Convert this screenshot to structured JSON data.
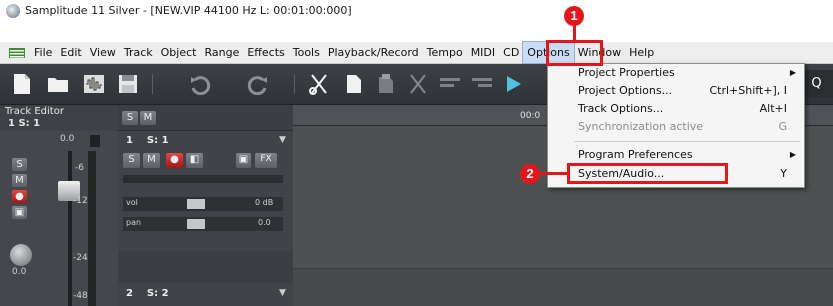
{
  "window": {
    "title": "Samplitude 11 Silver - [NEW.VIP   44100 Hz L: 00:01:00:000]"
  },
  "menubar": {
    "items": [
      "File",
      "Edit",
      "View",
      "Track",
      "Object",
      "Range",
      "Effects",
      "Tools",
      "Playback/Record",
      "Tempo",
      "MIDI",
      "CD",
      "Options",
      "Window",
      "Help"
    ],
    "active_item": "Options"
  },
  "toolbar": {
    "right_icon": "Q"
  },
  "track_editor": {
    "title": "Track Editor",
    "track_label": "1   S: 1",
    "s_button": "S",
    "m_button": "M",
    "level_top": "0.0",
    "pan_value": "0.0",
    "tick_a": "-6",
    "tick_b": "-12",
    "tick_c": "-24",
    "tick_d": "-48"
  },
  "track1": {
    "header": "1    S: 1",
    "fx": "FX",
    "vol_label": "vol",
    "vol_value": "0 dB",
    "pan_label": "pan",
    "pan_value": "0.0"
  },
  "track2": {
    "header": "2    S: 2"
  },
  "timeline": {
    "marker": "00:0"
  },
  "options_menu": {
    "items": [
      {
        "label": "Project Properties",
        "shortcut": "",
        "submenu": true,
        "disabled": false
      },
      {
        "label": "Project Options...",
        "shortcut": "Ctrl+Shift+], I",
        "submenu": false,
        "disabled": false
      },
      {
        "label": "Track Options...",
        "shortcut": "Alt+I",
        "submenu": false,
        "disabled": false
      },
      {
        "label": "Synchronization active",
        "shortcut": "G",
        "submenu": false,
        "disabled": true
      },
      {
        "label": "Program Preferences",
        "shortcut": "",
        "submenu": true,
        "disabled": false
      },
      {
        "label": "System/Audio...",
        "shortcut": "Y",
        "submenu": false,
        "disabled": false
      }
    ]
  },
  "callouts": {
    "step1": "1",
    "step2": "2"
  },
  "colors": {
    "highlight": "#e3171b",
    "menu_active": "#c8dcf3"
  }
}
